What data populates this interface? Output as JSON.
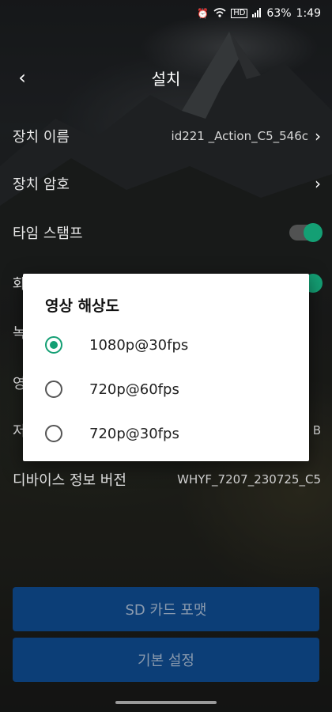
{
  "status_bar": {
    "alarm_icon": "alarm-icon",
    "wifi_icon": "wifi-icon",
    "hd_label": "HD",
    "signal_icon": "signal-icon",
    "battery": "63%",
    "time": "1:49"
  },
  "header": {
    "back_icon": "chevron-left-icon",
    "title": "설치"
  },
  "settings": {
    "device_name_label": "장치 이름",
    "device_name_value": "id221 _Action_C5_546c",
    "device_password_label": "장치 암호",
    "timestamp_label": "타임 스탬프",
    "row4_label_partial": "화",
    "row5_label_partial": "녹",
    "row6_label_partial": "영",
    "row7_label_partial": "저",
    "row7_value_partial": "B",
    "device_info_label": "디바이스 정보 버전",
    "device_info_value": "WHYF_7207_230725_C5"
  },
  "buttons": {
    "sd_format": "SD 카드 포맷",
    "default_settings": "기본 설정"
  },
  "dialog": {
    "title": "영상 해상도",
    "options": [
      {
        "label": "1080p@30fps",
        "selected": true
      },
      {
        "label": "720p@60fps",
        "selected": false
      },
      {
        "label": "720p@30fps",
        "selected": false
      }
    ]
  },
  "colors": {
    "accent": "#149f74",
    "button_bg": "#0c3e77"
  }
}
